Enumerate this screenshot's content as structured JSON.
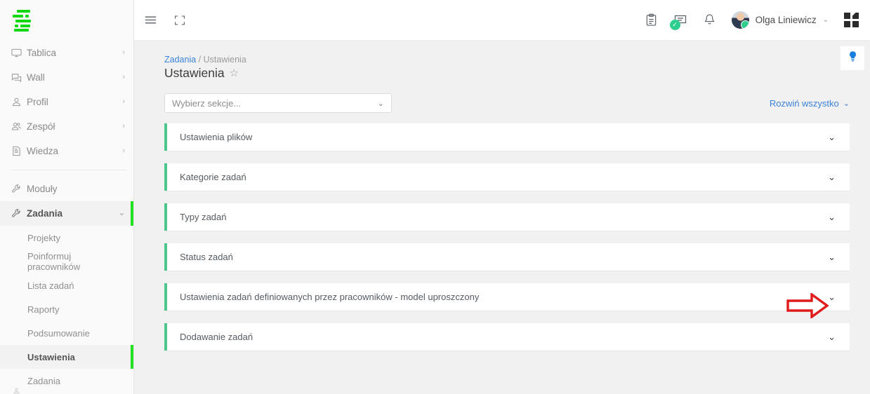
{
  "brand": {
    "logo_name": "app-logo",
    "logo_color": "#12d812"
  },
  "colors": {
    "accent_green": "#4dc68e",
    "nav_active_green": "#22e022",
    "link_blue": "#3c82d6",
    "hint_blue": "#1a7ee0",
    "annotation_red": "#e01b1b"
  },
  "sidebar": {
    "items": [
      {
        "label": "Tablica",
        "icon": "monitor-icon",
        "chevron": "›"
      },
      {
        "label": "Wall",
        "icon": "chat-icon",
        "chevron": "›"
      },
      {
        "label": "Profil",
        "icon": "user-icon",
        "chevron": "›"
      },
      {
        "label": "Zespół",
        "icon": "users-icon",
        "chevron": "›"
      },
      {
        "label": "Wiedza",
        "icon": "document-icon",
        "chevron": "›"
      }
    ],
    "modules": [
      {
        "label": "Moduły",
        "icon": "wrench-icon",
        "chevron": "",
        "active": false
      },
      {
        "label": "Zadania",
        "icon": "wrench-icon",
        "chevron": "⌄",
        "active": true
      }
    ],
    "subitems": [
      {
        "label": "Projekty",
        "active": false
      },
      {
        "label": "Poinformuj pracowników",
        "active": false
      },
      {
        "label": "Lista zadań",
        "active": false
      },
      {
        "label": "Raporty",
        "active": false
      },
      {
        "label": "Podsumowanie",
        "active": false
      },
      {
        "label": "Ustawienia",
        "active": true
      },
      {
        "label": "Zadania",
        "active": false
      }
    ]
  },
  "topbar": {
    "menu_icon": "hamburger-icon",
    "fullscreen_icon": "fullscreen-icon",
    "clipboard_icon": "clipboard-icon",
    "messages_icon": "messages-icon",
    "messages_badge": "✓",
    "bell_icon": "bell-icon",
    "user_name": "Olga Liniewicz",
    "user_caret": "⌄",
    "apps_icon": "apps-grid-icon"
  },
  "page": {
    "breadcrumb_link": "Zadania",
    "breadcrumb_sep": "/",
    "breadcrumb_current": "Ustawienia",
    "title": "Ustawienia",
    "favorite_icon": "☆",
    "hint_icon": "lightbulb-icon"
  },
  "toolbar": {
    "section_select_placeholder": "Wybierz sekcje...",
    "section_select_value": "",
    "select_caret": "⌄",
    "expand_all_label": "Rozwiń wszystko",
    "expand_all_caret": "⌄"
  },
  "accordion": {
    "chevron": "⌄",
    "panels": [
      {
        "title": "Ustawienia plików",
        "expanded": false
      },
      {
        "title": "Kategorie zadań",
        "expanded": false
      },
      {
        "title": "Typy zadań",
        "expanded": false
      },
      {
        "title": "Status zadań",
        "expanded": false
      },
      {
        "title": "Ustawienia zadań definiowanych przez pracowników - model uproszczony",
        "expanded": false
      },
      {
        "title": "Dodawanie zadań",
        "expanded": false
      }
    ]
  },
  "annotation": {
    "type": "arrow-right",
    "points_to": "panel-5-chevron"
  }
}
